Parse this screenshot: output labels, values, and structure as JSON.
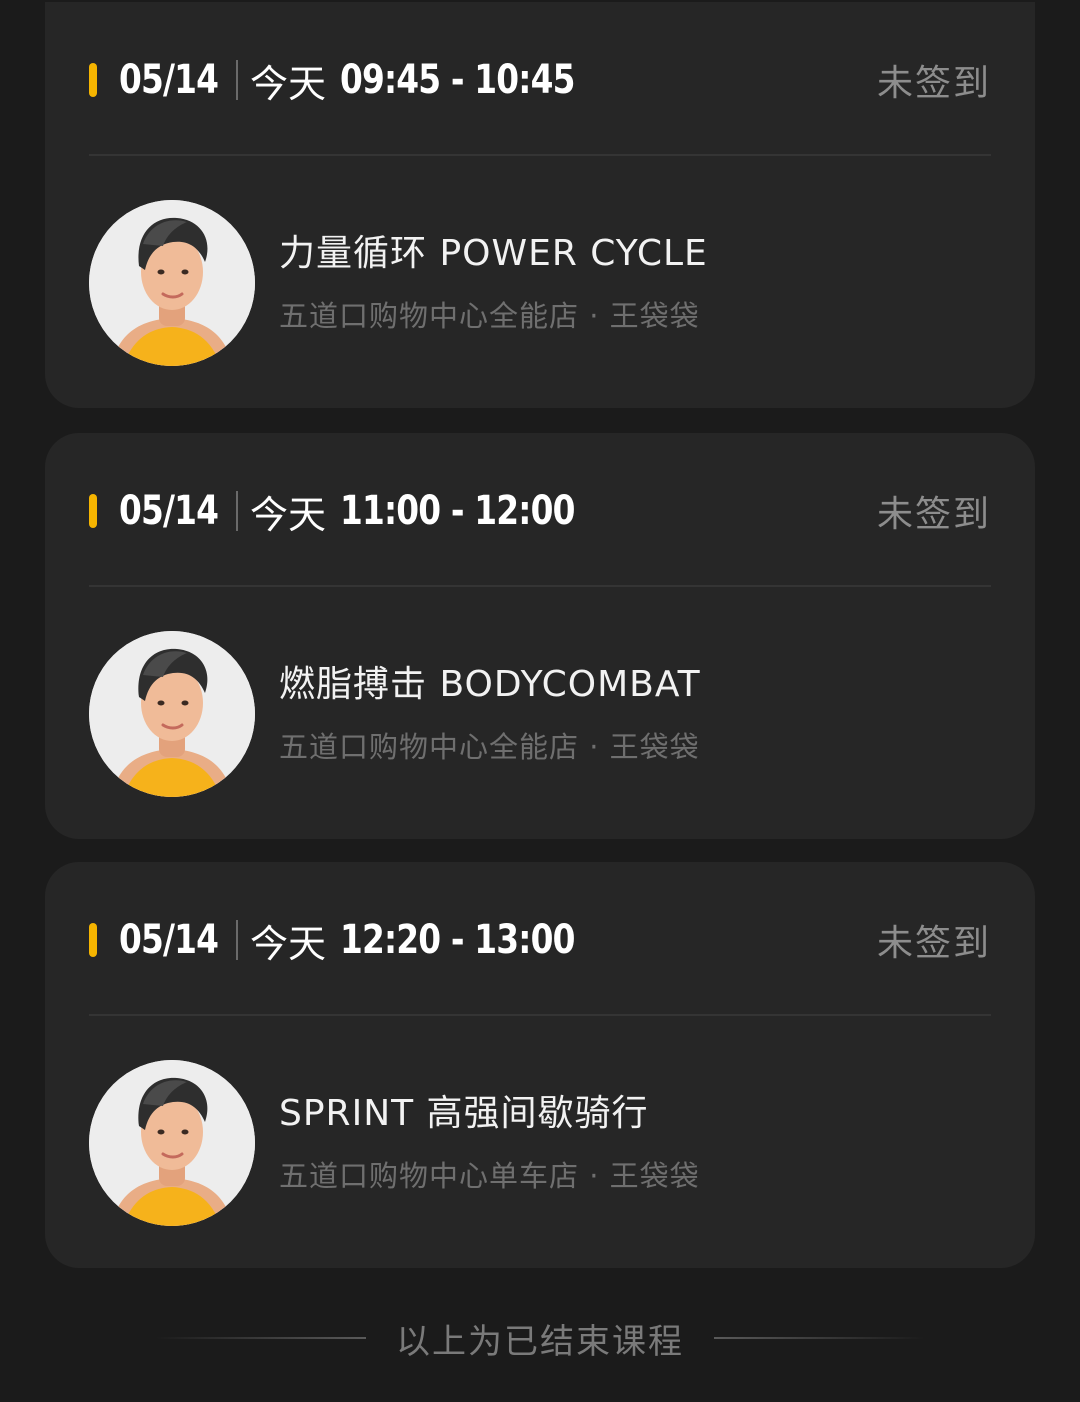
{
  "sessions": [
    {
      "date": "05/14",
      "day": "今天",
      "time": "09:45 - 10:45",
      "status": "未签到",
      "class_name": "力量循环 POWER CYCLE",
      "location": "五道口购物中心全能店 · 王袋袋",
      "avatar_icon": "instructor-avatar"
    },
    {
      "date": "05/14",
      "day": "今天",
      "time": "11:00 - 12:00",
      "status": "未签到",
      "class_name": "燃脂搏击 BODYCOMBAT",
      "location": "五道口购物中心全能店 · 王袋袋",
      "avatar_icon": "instructor-avatar"
    },
    {
      "date": "05/14",
      "day": "今天",
      "time": "12:20 - 13:00",
      "status": "未签到",
      "class_name": "SPRINT 高强间歇骑行",
      "location": "五道口购物中心单车店 · 王袋袋",
      "avatar_icon": "instructor-avatar"
    }
  ],
  "footer": {
    "text": "以上为已结束课程"
  },
  "colors": {
    "accent": "#f5b400",
    "background": "#1b1b1b",
    "card": "#262626",
    "muted": "#8d8d8d"
  }
}
